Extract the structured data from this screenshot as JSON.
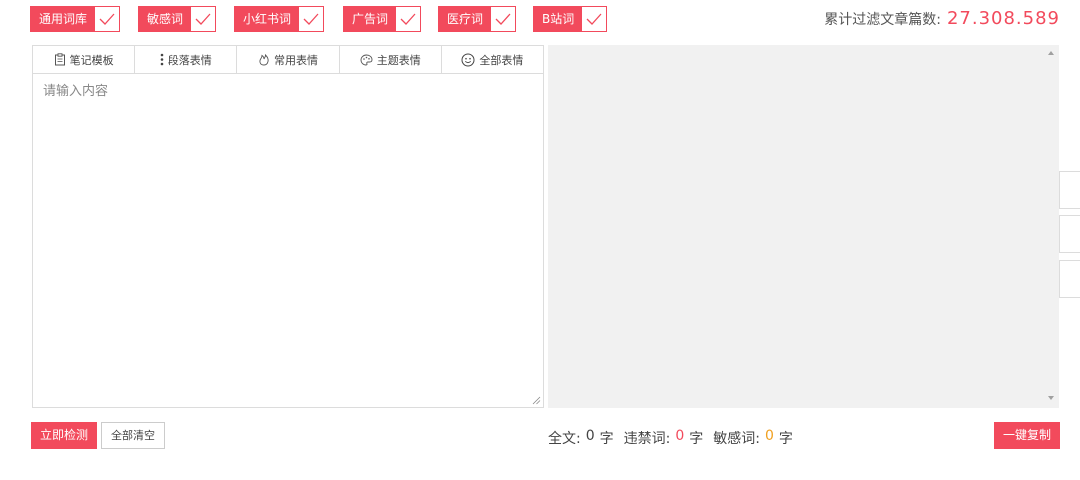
{
  "filters": [
    {
      "label": "通用词库",
      "checked": true
    },
    {
      "label": "敏感词",
      "checked": true
    },
    {
      "label": "小红书词",
      "checked": true
    },
    {
      "label": "广告词",
      "checked": true
    },
    {
      "label": "医疗词",
      "checked": true
    },
    {
      "label": "B站词",
      "checked": true
    }
  ],
  "stats": {
    "label": "累计过滤文章篇数:",
    "value": "27.308.589"
  },
  "toolbar": [
    {
      "label": "笔记模板",
      "icon": "note-template-icon"
    },
    {
      "label": "段落表情",
      "icon": "vertical-dots-icon"
    },
    {
      "label": "常用表情",
      "icon": "fire-icon"
    },
    {
      "label": "主题表情",
      "icon": "palette-icon"
    },
    {
      "label": "全部表情",
      "icon": "smiley-icon"
    }
  ],
  "editor": {
    "placeholder": "请输入内容"
  },
  "actions": {
    "detect": "立即检测",
    "clear": "全部清空",
    "copy": "一键复制"
  },
  "counts": {
    "total_label": "全文:",
    "total_value": "0",
    "unit": "字",
    "banned_label": "违禁词:",
    "banned_value": "0",
    "sensitive_label": "敏感词:",
    "sensitive_value": "0"
  },
  "colors": {
    "accent": "#f24a5c",
    "orange": "#f0a020",
    "panel": "#f1f1f1"
  }
}
